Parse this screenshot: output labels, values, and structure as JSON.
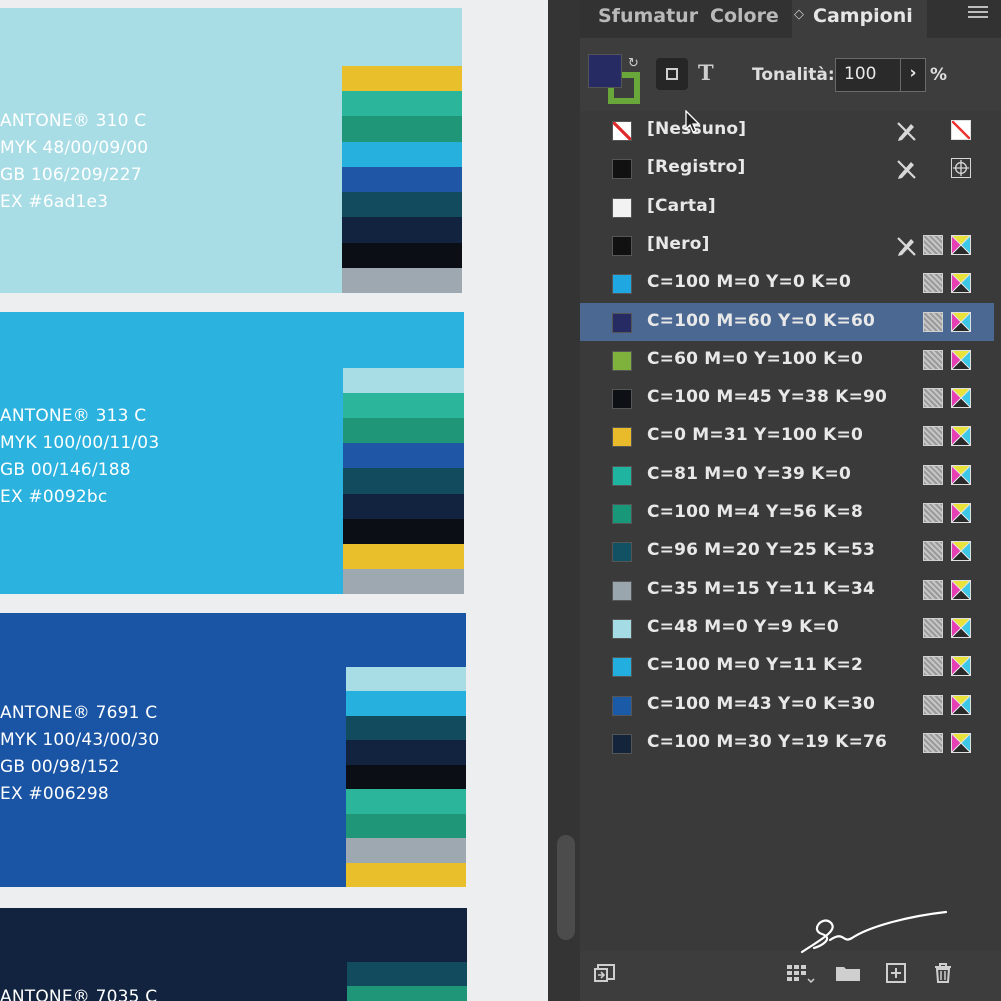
{
  "document": {
    "cards": [
      {
        "lines": [
          "ANTONE® 310 C",
          "MYK 48/00/09/00",
          "GB 106/209/227",
          "EX #6ad1e3"
        ],
        "color": "#a8dde6",
        "text_color": "#ffffff",
        "stack": [
          "#e9c02c",
          "#2bb59b",
          "#1e9677",
          "#26b0dd",
          "#1f57a6",
          "#134b5e",
          "#12233f",
          "#0b0e14",
          "#9da8b0"
        ]
      },
      {
        "lines": [
          "ANTONE® 313 C",
          "MYK 100/00/11/03",
          "GB 00/146/188",
          "EX #0092bc"
        ],
        "color": "#2cb2de",
        "text_color": "#ffffff",
        "stack": [
          "#a8dde6",
          "#2bb59b",
          "#1e9677",
          "#1f57a6",
          "#134b5e",
          "#12233f",
          "#0b0e14",
          "#e9c02c",
          "#9da8b0"
        ]
      },
      {
        "lines": [
          "ANTONE® 7691 C",
          "MYK 100/43/00/30",
          "GB 00/98/152",
          "EX #006298"
        ],
        "color": "#1a55a5",
        "text_color": "#ffffff",
        "stack": [
          "#a8dde6",
          "#26b0dd",
          "#134b5e",
          "#12233f",
          "#0b0e14",
          "#2bb59b",
          "#1e9677",
          "#9da8b0",
          "#e9c02c"
        ]
      },
      {
        "lines": [
          "ANTONE® 7035 C"
        ],
        "color": "#12233f",
        "text_color": "#ffffff",
        "stack": [
          "#134b5e",
          "#1e9677"
        ]
      }
    ]
  },
  "panel": {
    "tabs": [
      {
        "label": "Sfumatur",
        "active": false
      },
      {
        "label": "Colore",
        "active": false
      },
      {
        "label": "Campioni",
        "active": true
      }
    ],
    "tab_collapse_glyph": "◇",
    "toolbar": {
      "fill_color": "#262b63",
      "stroke_color": "#6aa73b",
      "swap_glyph": "↻",
      "text_button": "T",
      "tint_label": "Tonalità:",
      "tint_value": "100",
      "tint_arrow": "›",
      "tint_unit": "%"
    },
    "swatches": [
      {
        "name": "[Nessuno]",
        "color": "none",
        "icons": [
          "pencil-lock",
          "none"
        ]
      },
      {
        "name": "[Registro]",
        "color": "#111111",
        "icons": [
          "pencil-lock",
          "registration"
        ]
      },
      {
        "name": "[Carta]",
        "color": "#f2f2f2",
        "icons": []
      },
      {
        "name": "[Nero]",
        "color": "#111111",
        "icons": [
          "pencil-lock",
          "process",
          "cmyk"
        ]
      },
      {
        "name": "C=100 M=0 Y=0 K=0",
        "color": "#1ea7e1",
        "icons": [
          "process",
          "cmyk"
        ]
      },
      {
        "name": "C=100 M=60 Y=0 K=60",
        "color": "#262b63",
        "icons": [
          "process",
          "cmyk"
        ],
        "selected": true
      },
      {
        "name": "C=60 M=0 Y=100 K=0",
        "color": "#7fb23d",
        "icons": [
          "process",
          "cmyk"
        ]
      },
      {
        "name": "C=100 M=45 Y=38 K=90",
        "color": "#0d1116",
        "icons": [
          "process",
          "cmyk"
        ]
      },
      {
        "name": "C=0 M=31 Y=100 K=0",
        "color": "#e9bb2a",
        "icons": [
          "process",
          "cmyk"
        ]
      },
      {
        "name": "C=81 M=0 Y=39 K=0",
        "color": "#1fb49f",
        "icons": [
          "process",
          "cmyk"
        ]
      },
      {
        "name": "C=100 M=4 Y=56 K=8",
        "color": "#189879",
        "icons": [
          "process",
          "cmyk"
        ]
      },
      {
        "name": "C=96 M=20 Y=25 K=53",
        "color": "#125063",
        "icons": [
          "process",
          "cmyk"
        ]
      },
      {
        "name": "C=35 M=15 Y=11 K=34",
        "color": "#9aa6ad",
        "icons": [
          "process",
          "cmyk"
        ]
      },
      {
        "name": "C=48 M=0 Y=9 K=0",
        "color": "#a4dbe4",
        "icons": [
          "process",
          "cmyk"
        ]
      },
      {
        "name": "C=100 M=0 Y=11 K=2",
        "color": "#23aee0",
        "icons": [
          "process",
          "cmyk"
        ]
      },
      {
        "name": "C=100 M=43 Y=0 K=30",
        "color": "#1b5aa6",
        "icons": [
          "process",
          "cmyk"
        ]
      },
      {
        "name": "C=100 M=30 Y=19 K=76",
        "color": "#14243b",
        "icons": [
          "process",
          "cmyk"
        ]
      }
    ],
    "bottom_icons": [
      "swatch-view-icon",
      "new-color-group-options-icon",
      "new-color-group-icon",
      "new-swatch-icon",
      "delete-swatch-icon"
    ]
  }
}
